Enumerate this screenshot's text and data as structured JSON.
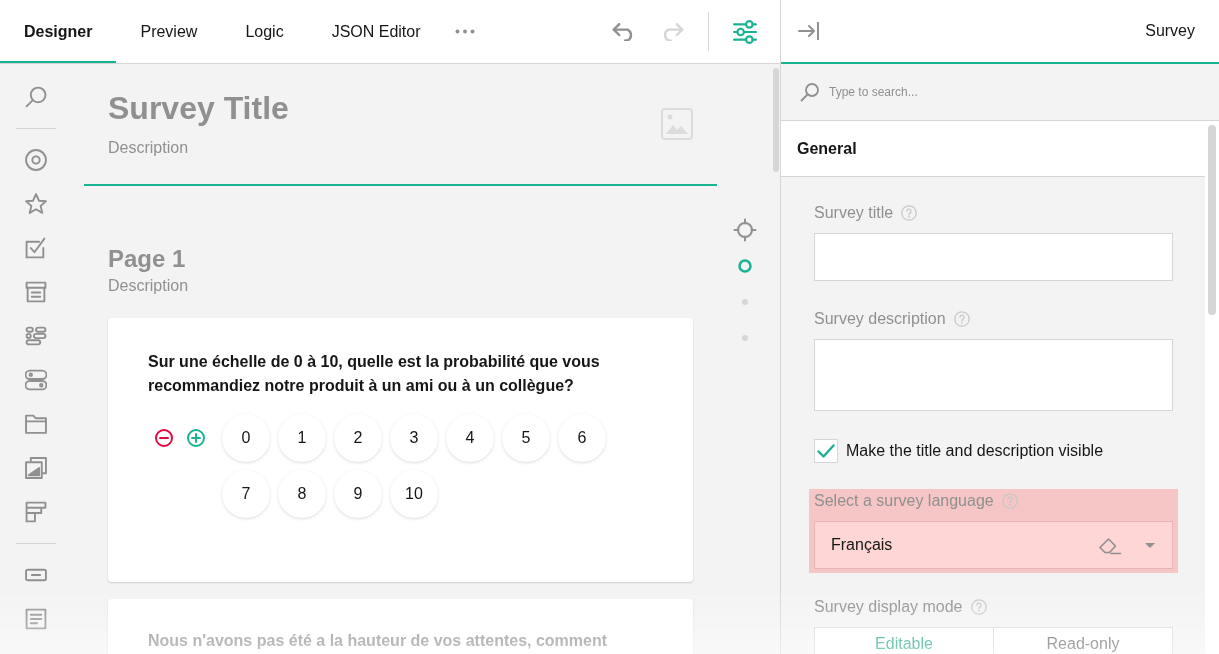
{
  "toolbar": {
    "tabs": [
      {
        "label": "Designer",
        "selected": true
      },
      {
        "label": "Preview",
        "selected": false
      },
      {
        "label": "Logic",
        "selected": false
      },
      {
        "label": "JSON Editor",
        "selected": false
      }
    ],
    "undo": {
      "disabled": false
    },
    "redo": {
      "disabled": true
    },
    "settings": {
      "on": true
    }
  },
  "survey": {
    "title": "Survey Title",
    "description": "Description"
  },
  "page": {
    "title": "Page 1",
    "description": "Description"
  },
  "questions": [
    {
      "kind": "rating",
      "title": "Sur une échelle de 0 à 10, quelle est la probabilité que vous recommandiez notre produit à un ami ou à un collègue?",
      "rate_values": [
        "0",
        "1",
        "2",
        "3",
        "4",
        "5",
        "6",
        "7",
        "8",
        "9",
        "10"
      ]
    },
    {
      "kind": "text",
      "title": "Nous n'avons pas été a la hauteur de vos attentes, comment"
    }
  ],
  "page_nav": [
    {
      "selected": true
    },
    {
      "selected": false
    },
    {
      "selected": false
    }
  ],
  "property_grid": {
    "title": "Survey",
    "search": {
      "placeholder": "Type to search..."
    },
    "sections": [
      {
        "title": "General",
        "expanded": true,
        "properties": [
          {
            "kind": "text",
            "label": "Survey title"
          },
          {
            "kind": "textarea",
            "label": "Survey description"
          },
          {
            "kind": "checkbox",
            "label": "Make the title and description visible",
            "checked": true
          },
          {
            "kind": "dropdown",
            "label": "Select a survey language",
            "value": "Français",
            "highlighted": true
          },
          {
            "kind": "buttongroup",
            "label": "Survey display mode",
            "options": [
              {
                "label": "Editable",
                "selected": true
              },
              {
                "label": "Read-only",
                "selected": false
              }
            ]
          }
        ]
      }
    ]
  }
}
